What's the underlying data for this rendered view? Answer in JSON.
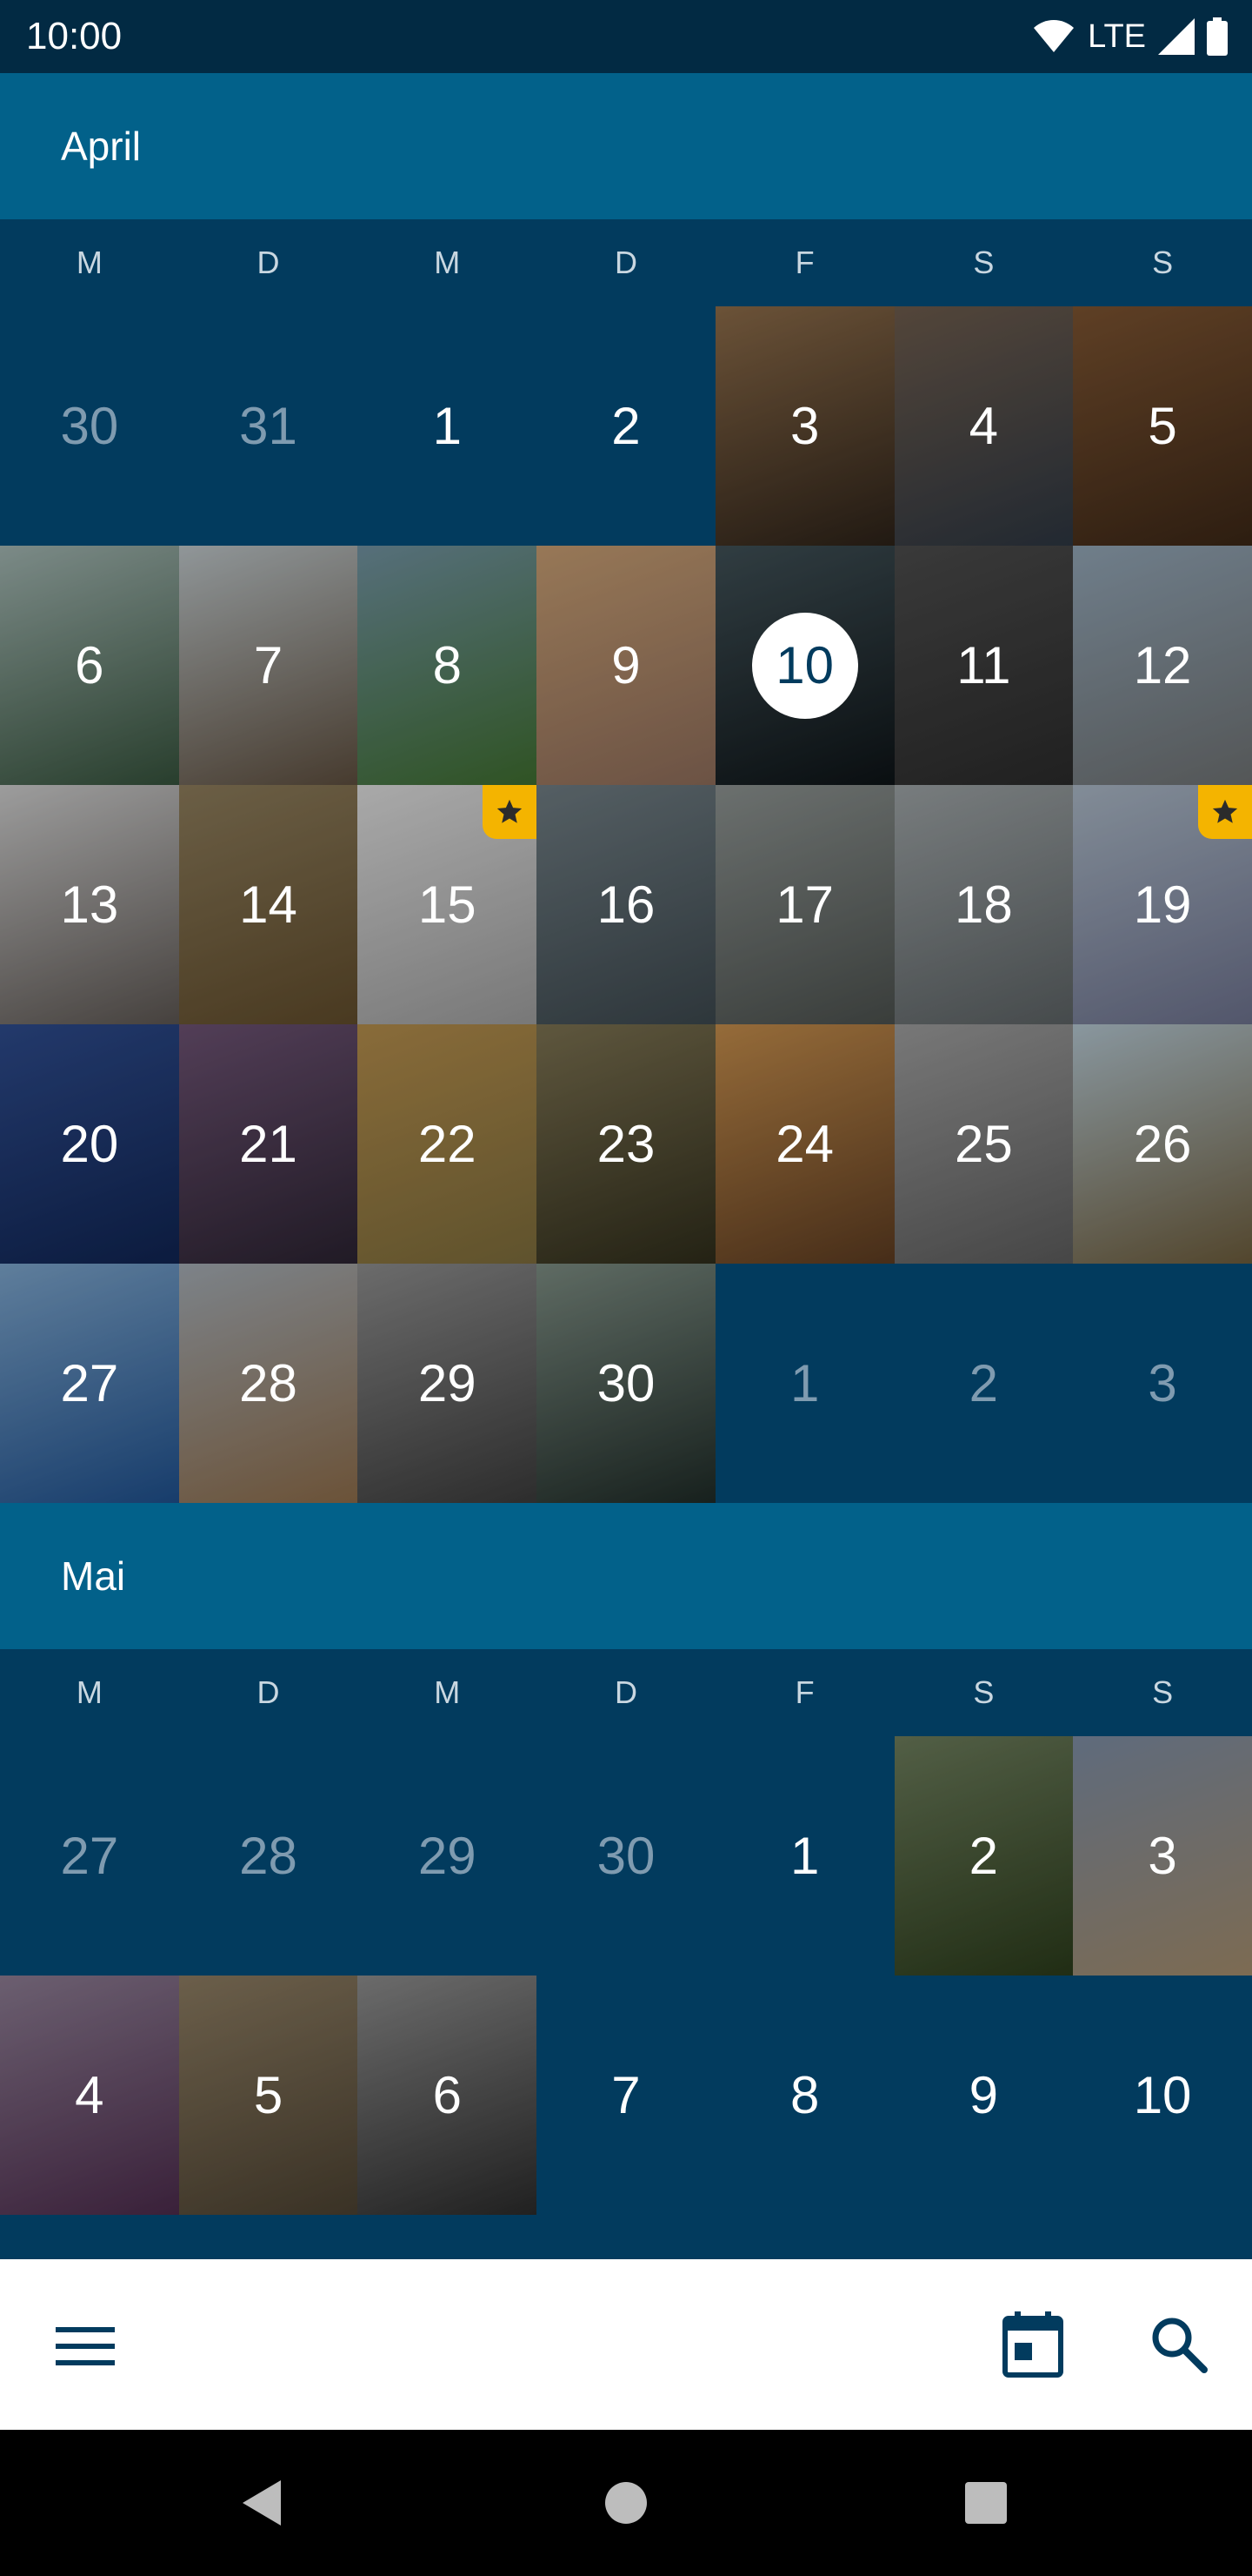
{
  "status_bar": {
    "time": "10:00",
    "network": "LTE"
  },
  "weekday_labels": [
    "M",
    "D",
    "M",
    "D",
    "F",
    "S",
    "S"
  ],
  "months": [
    {
      "name": "April",
      "days": [
        {
          "label": "30",
          "type": "other_month"
        },
        {
          "label": "31",
          "type": "other_month"
        },
        {
          "label": "1",
          "type": "plain"
        },
        {
          "label": "2",
          "type": "plain"
        },
        {
          "label": "3",
          "type": "photo",
          "photo": "laptop-coffee"
        },
        {
          "label": "4",
          "type": "photo",
          "photo": "laptop-hands"
        },
        {
          "label": "5",
          "type": "photo",
          "photo": "laptop-desk"
        },
        {
          "label": "6",
          "type": "photo",
          "photo": "river-mist"
        },
        {
          "label": "7",
          "type": "photo",
          "photo": "rocky-shore"
        },
        {
          "label": "8",
          "type": "photo",
          "photo": "forest-path"
        },
        {
          "label": "9",
          "type": "photo",
          "photo": "desk-items"
        },
        {
          "label": "10",
          "type": "photo",
          "photo": "dark-plant",
          "today": true
        },
        {
          "label": "11",
          "type": "photo",
          "photo": "flat-lay"
        },
        {
          "label": "12",
          "type": "photo",
          "photo": "mountain-snow"
        },
        {
          "label": "13",
          "type": "photo",
          "photo": "bench-wall"
        },
        {
          "label": "14",
          "type": "photo",
          "photo": "grass-seed"
        },
        {
          "label": "15",
          "type": "photo",
          "photo": "gadgets",
          "favorite": true
        },
        {
          "label": "16",
          "type": "photo",
          "photo": "water-drops"
        },
        {
          "label": "17",
          "type": "photo",
          "photo": "foggy-coast"
        },
        {
          "label": "18",
          "type": "photo",
          "photo": "pier-fog"
        },
        {
          "label": "19",
          "type": "photo",
          "photo": "boat-rope",
          "favorite": true
        },
        {
          "label": "20",
          "type": "photo",
          "photo": "cloud-sky"
        },
        {
          "label": "21",
          "type": "photo",
          "photo": "bokeh"
        },
        {
          "label": "22",
          "type": "photo",
          "photo": "fence-field"
        },
        {
          "label": "23",
          "type": "photo",
          "photo": "misty-hills"
        },
        {
          "label": "24",
          "type": "photo",
          "photo": "sunset-hair"
        },
        {
          "label": "25",
          "type": "photo",
          "photo": "boardwalk"
        },
        {
          "label": "26",
          "type": "photo",
          "photo": "swing-coast"
        },
        {
          "label": "27",
          "type": "photo",
          "photo": "sea-city"
        },
        {
          "label": "28",
          "type": "photo",
          "photo": "jetty-hut"
        },
        {
          "label": "29",
          "type": "photo",
          "photo": "pine-cone"
        },
        {
          "label": "30",
          "type": "photo",
          "photo": "forest-dusk"
        },
        {
          "label": "1",
          "type": "other_month"
        },
        {
          "label": "2",
          "type": "other_month"
        },
        {
          "label": "3",
          "type": "other_month"
        }
      ]
    },
    {
      "name": "Mai",
      "days": [
        {
          "label": "27",
          "type": "other_month"
        },
        {
          "label": "28",
          "type": "other_month"
        },
        {
          "label": "29",
          "type": "other_month"
        },
        {
          "label": "30",
          "type": "other_month"
        },
        {
          "label": "1",
          "type": "plain"
        },
        {
          "label": "2",
          "type": "photo",
          "photo": "grass-bokeh"
        },
        {
          "label": "3",
          "type": "photo",
          "photo": "beach-shells"
        },
        {
          "label": "4",
          "type": "photo",
          "photo": "purple-tree"
        },
        {
          "label": "5",
          "type": "photo",
          "photo": "wheat"
        },
        {
          "label": "6",
          "type": "photo",
          "photo": "wagon-wheel"
        },
        {
          "label": "7",
          "type": "plain"
        },
        {
          "label": "8",
          "type": "plain"
        },
        {
          "label": "9",
          "type": "plain"
        },
        {
          "label": "10",
          "type": "plain"
        }
      ]
    }
  ],
  "photo_colors": {
    "laptop-coffee": [
      "#8a6a48",
      "#2b2118"
    ],
    "laptop-hands": [
      "#6b5a4b",
      "#2c3540"
    ],
    "laptop-desk": [
      "#7a5230",
      "#3a2616"
    ],
    "river-mist": [
      "#9fb2ae",
      "#34503a"
    ],
    "rocky-shore": [
      "#b9c1c4",
      "#5b4c3c"
    ],
    "forest-path": [
      "#6f8f9e",
      "#3d6b2e"
    ],
    "desk-items": [
      "#c29a70",
      "#8a6a58"
    ],
    "dark-plant": [
      "#3f4f55",
      "#0d1316"
    ],
    "flat-lay": [
      "#4a4a4a",
      "#2a2a2a"
    ],
    "mountain-snow": [
      "#8fa2b2",
      "#6c6f70"
    ],
    "bench-wall": [
      "#c9c9c9",
      "#5a5450"
    ],
    "grass-seed": [
      "#8a7a5a",
      "#5e4a2a"
    ],
    "gadgets": [
      "#d9d9d9",
      "#9a9a9a"
    ],
    "water-drops": [
      "#6d7a80",
      "#3b464c"
    ],
    "foggy-coast": [
      "#8a908e",
      "#4a4f4c"
    ],
    "pier-fog": [
      "#9aa0a2",
      "#5a6062"
    ],
    "boat-rope": [
      "#a7b4c2",
      "#6a6f8a"
    ],
    "cloud-sky": [
      "#2d4a8a",
      "#0f2350"
    ],
    "bokeh": [
      "#6a5070",
      "#2a2230"
    ],
    "fence-field": [
      "#b08a4a",
      "#7a6a3a"
    ],
    "misty-hills": [
      "#7a7050",
      "#2e2c1a"
    ],
    "sunset-hair": [
      "#c08a4a",
      "#5a3a20"
    ],
    "boardwalk": [
      "#9a9a9a",
      "#5a5a5a"
    ],
    "swing-coast": [
      "#b0c2cc",
      "#6a5a3a"
    ],
    "sea-city": [
      "#7aa2c8",
      "#1e4e8a"
    ],
    "jetty-hut": [
      "#a0a8b0",
      "#8a6a48"
    ],
    "pine-cone": [
      "#8a8a8a",
      "#3a3a3a"
    ],
    "forest-dusk": [
      "#7a8a80",
      "#1e2a26"
    ],
    "grass-bokeh": [
      "#6a7a5a",
      "#2a3a1a"
    ],
    "beach-shells": [
      "#7a8aa0",
      "#a08a6a"
    ],
    "purple-tree": [
      "#8a7a90",
      "#4a2a4a"
    ],
    "wheat": [
      "#8a7a60",
      "#4a4030"
    ],
    "wagon-wheel": [
      "#8a8a8a",
      "#2a2a2a"
    ]
  },
  "colors": {
    "status_bar": "#022a43",
    "month_header": "#02618a",
    "grid_background": "#023b5e",
    "favorite_star": "#f4b400",
    "icon_tint": "#023b5e"
  },
  "bottom_bar": {
    "menu_icon": "menu-icon",
    "calendar_icon": "calendar-today-icon",
    "search_icon": "search-icon"
  },
  "nav_bar": {
    "back_icon": "back-icon",
    "home_icon": "home-icon",
    "recents_icon": "recents-icon"
  }
}
